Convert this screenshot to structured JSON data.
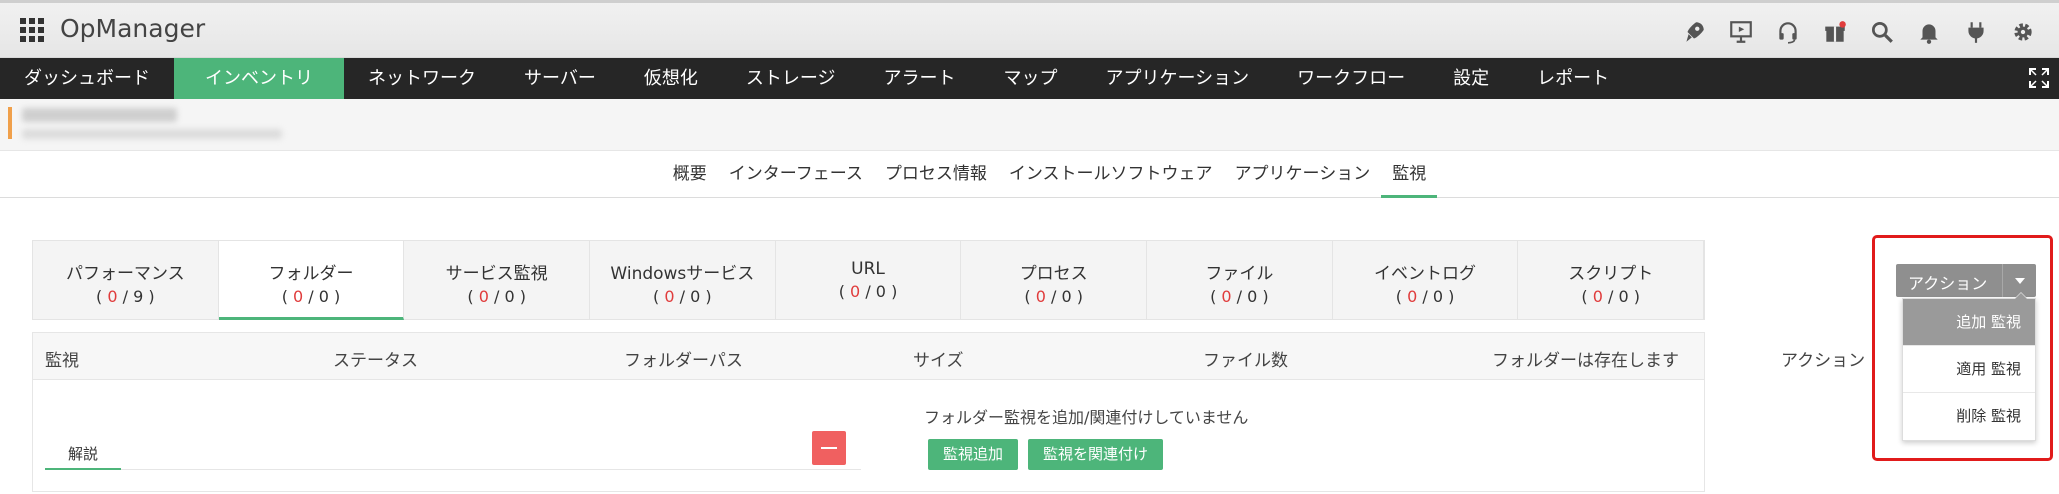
{
  "app": {
    "title": "OpManager"
  },
  "mainnav": {
    "items": [
      {
        "label": "ダッシュボード"
      },
      {
        "label": "インベントリ"
      },
      {
        "label": "ネットワーク"
      },
      {
        "label": "サーバー"
      },
      {
        "label": "仮想化"
      },
      {
        "label": "ストレージ"
      },
      {
        "label": "アラート"
      },
      {
        "label": "マップ"
      },
      {
        "label": "アプリケーション"
      },
      {
        "label": "ワークフロー"
      },
      {
        "label": "設定"
      },
      {
        "label": "レポート"
      }
    ],
    "active": "インベントリ"
  },
  "subtabs": [
    {
      "label": "概要"
    },
    {
      "label": "インターフェース"
    },
    {
      "label": "プロセス情報"
    },
    {
      "label": "インストールソフトウェア"
    },
    {
      "label": "アプリケーション"
    },
    {
      "label": "監視"
    }
  ],
  "categories": [
    {
      "label": "パフォーマンス",
      "down": "0",
      "total": "9"
    },
    {
      "label": "フォルダー",
      "down": "0",
      "total": "0"
    },
    {
      "label": "サービス監視",
      "down": "0",
      "total": "0"
    },
    {
      "label": "Windowsサービス",
      "down": "0",
      "total": "0"
    },
    {
      "label": "URL",
      "down": "0",
      "total": "0"
    },
    {
      "label": "プロセス",
      "down": "0",
      "total": "0"
    },
    {
      "label": "ファイル",
      "down": "0",
      "total": "0"
    },
    {
      "label": "イベントログ",
      "down": "0",
      "total": "0"
    },
    {
      "label": "スクリプト",
      "down": "0",
      "total": "0"
    }
  ],
  "table": {
    "columns": [
      "監視",
      "ステータス",
      "フォルダーパス",
      "サイズ",
      "ファイル数",
      "フォルダーは存在します",
      "アクション"
    ],
    "empty_message": "フォルダー監視を追加/関連付けしていません",
    "add_button": "監視追加",
    "associate_button": "監視を関連付け",
    "explain_tab": "解説"
  },
  "action": {
    "button_label": "アクション",
    "menu": [
      "追加 監視",
      "適用 監視",
      "削除 監視"
    ]
  },
  "colors": {
    "accent": "#4db57a",
    "nav_bg": "#262626",
    "highlight": "#e11b1b",
    "down": "#e03c3c"
  }
}
